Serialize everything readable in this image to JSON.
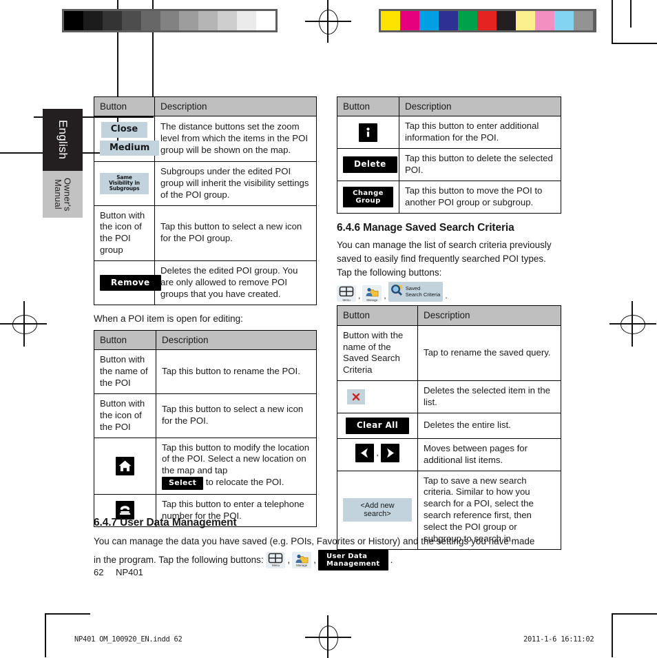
{
  "meta": {
    "page_number": "62",
    "model": "NP401",
    "print_footer_left": "NP401 OM_100920_EN.indd   62",
    "print_footer_right": "2011-1-6   16:11:02"
  },
  "sidetab": {
    "language": "English",
    "doc_type": "Owner's\nManual"
  },
  "colorbars": {
    "gray_label": "grayscale-calibration-bar",
    "gray_swatches": [
      "#000000",
      "#1c1c1c",
      "#333333",
      "#4d4d4d",
      "#676767",
      "#828282",
      "#9d9d9d",
      "#b5b5b5",
      "#cecece",
      "#ebebeb",
      "#ffffff"
    ],
    "color_label": "process-color-calibration-bar",
    "color_swatches": [
      "#fde300",
      "#e6007e",
      "#00a0e4",
      "#2e3192",
      "#00a14b",
      "#e52421",
      "#231f20",
      "#fbee8c",
      "#f490c1",
      "#82d4f2",
      "#939393"
    ]
  },
  "tables": {
    "poi_group": {
      "headers": [
        "Button",
        "Description"
      ],
      "rows": [
        {
          "button_type": "chip-stack",
          "buttons": [
            "Close",
            "Medium"
          ],
          "description": "The distance buttons set the zoom level from which the items in the POI group will be shown on the map."
        },
        {
          "button_type": "chip-wide",
          "buttons": [
            "Same Visibility in Subgroups"
          ],
          "description": "Subgroups under the edited POI group will inherit the visibility settings of the POI group."
        },
        {
          "button_type": "text",
          "buttons": [
            "Button with the icon of the POI group"
          ],
          "description": "Tap this button to select a new icon for the POI group."
        },
        {
          "button_type": "black",
          "buttons": [
            "Remove"
          ],
          "description": "Deletes the edited POI group. You are only allowed to remove POI groups that you have created."
        }
      ]
    },
    "poi_item_intro": "When a POI item is open for editing:",
    "poi_item": {
      "headers": [
        "Button",
        "Description"
      ],
      "rows": [
        {
          "button_type": "text",
          "buttons": [
            "Button with the name of the POI"
          ],
          "description": "Tap this button to rename the POI."
        },
        {
          "button_type": "text",
          "buttons": [
            "Button with the icon of the POI"
          ],
          "description": "Tap this button to select a new icon for the POI."
        },
        {
          "button_type": "icon",
          "icon": "home-icon",
          "description_pre": "Tap this button to modify the location of the POI. Select a new location on the map and tap",
          "inline_button": "Select",
          "description_post": "to relocate the POI."
        },
        {
          "button_type": "icon",
          "icon": "telephone-icon",
          "description": "Tap this button to enter a telephone number for the POI."
        }
      ]
    },
    "poi_item_right": {
      "headers": [
        "Button",
        "Description"
      ],
      "rows": [
        {
          "button_type": "icon",
          "icon": "information-icon",
          "description": "Tap this button to enter additional information for the POI."
        },
        {
          "button_type": "black",
          "buttons": [
            "Delete"
          ],
          "description": "Tap this button to delete the selected POI."
        },
        {
          "button_type": "black-two",
          "buttons": [
            "Change",
            "Group"
          ],
          "description": "Tap this button to move the POI to another POI group or subgroup."
        }
      ]
    },
    "saved_search": {
      "headers": [
        "Button",
        "Description"
      ],
      "rows": [
        {
          "button_type": "text",
          "buttons": [
            "Button with the name of the Saved Search Criteria"
          ],
          "description": "Tap to rename the saved query."
        },
        {
          "button_type": "chip-icon",
          "icon": "delete-x-icon",
          "description": "Deletes the selected item in the list."
        },
        {
          "button_type": "black",
          "buttons": [
            "Clear All"
          ],
          "description": "Deletes the entire list."
        },
        {
          "button_type": "arrows",
          "icons": [
            "arrow-left-icon",
            "arrow-right-icon"
          ],
          "description": "Moves between pages for additional list items."
        },
        {
          "button_type": "chip-addnew",
          "buttons": [
            "<Add new search>"
          ],
          "description": "Tap to save a new search criteria. Similar to how you search for a POI, select the search reference first, then select the POI group or subgroup to search in."
        }
      ]
    }
  },
  "sections": {
    "s646": {
      "number_title": "6.4.6 Manage Saved Search Criteria",
      "paragraph": "You can manage the list of search criteria previously saved to easily find frequently searched POI types. Tap the following buttons:",
      "nav_sequence": {
        "menu_caption": "Menu",
        "manage_caption": "Manage",
        "saved_label_line1": "Saved",
        "saved_label_line2": "Search Criteria",
        "separator": ",",
        "terminator": "."
      }
    },
    "s647": {
      "number_title": "6.4.7 User Data Management",
      "paragraph_line1": "You can manage the data you have saved (e.g. POIs, Favorites or History) and the settings you have made",
      "paragraph_line2": "in the program. Tap the following buttons:",
      "nav_sequence": {
        "menu_caption": "Menu",
        "manage_caption": "Manage",
        "user_data_line1": "User Data",
        "user_data_line2": "Management",
        "separator": ",",
        "terminator": "."
      }
    }
  }
}
